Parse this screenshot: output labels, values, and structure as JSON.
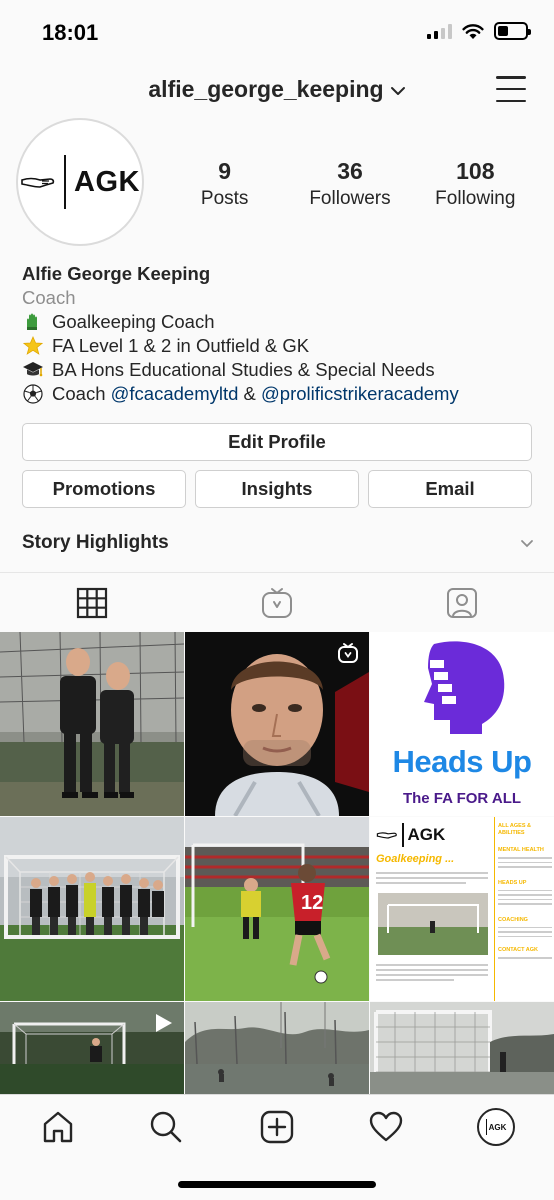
{
  "status": {
    "time": "18:01"
  },
  "header": {
    "username": "alfie_george_keeping"
  },
  "profile": {
    "logo_text": "AGK",
    "stats": [
      {
        "num": "9",
        "label": "Posts"
      },
      {
        "num": "36",
        "label": "Followers"
      },
      {
        "num": "108",
        "label": "Following"
      }
    ]
  },
  "bio": {
    "name": "Alfie George Keeping",
    "category": "Coach",
    "line1": "Goalkeeping Coach",
    "line2": "FA Level 1 & 2 in Outfield & GK",
    "line3": "BA Hons Educational Studies & Special Needs",
    "line4_prefix": "Coach ",
    "mention1": "@fcacademyltd",
    "line4_mid": " & ",
    "mention2": "@prolificstrikeracademy"
  },
  "buttons": {
    "edit_profile": "Edit Profile",
    "promotions": "Promotions",
    "insights": "Insights",
    "email": "Email"
  },
  "highlights": {
    "label": "Story Highlights"
  },
  "posts": {
    "heads_up_title": "Heads Up",
    "heads_up_tagline": "The FA FOR ALL",
    "flyer_title": "Goalkeeping ...",
    "flyer_logo": "AGK",
    "flyer_side_heading1": "ALL AGES & ABILITIES",
    "flyer_side_heading2": "MENTAL HEALTH",
    "flyer_side_heading3": "HEADS UP",
    "flyer_side_heading4": "COACHING",
    "flyer_side_heading5": "CONTACT AGK",
    "jersey_number": "12"
  },
  "colors": {
    "accent_link": "#00376b",
    "heads_up_purple": "#6b2bd9",
    "heads_up_blue": "#1e88e5",
    "flyer_yellow": "#f5b800"
  },
  "icons": [
    "grid-icon",
    "igtv-icon",
    "tagged-icon",
    "home-icon",
    "search-icon",
    "add-post-icon",
    "heart-icon",
    "profile-icon"
  ]
}
